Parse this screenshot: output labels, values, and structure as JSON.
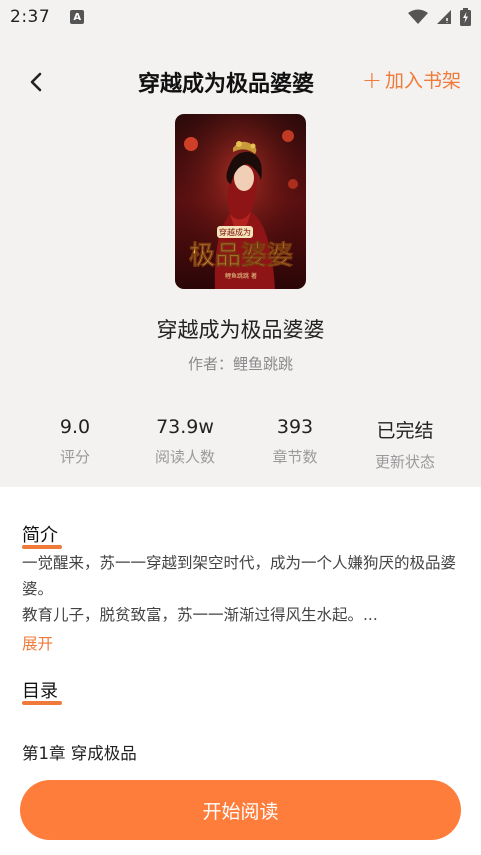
{
  "status_bar": {
    "time": "2:37",
    "notification_letter": "A"
  },
  "header": {
    "title": "穿越成为极品婆婆",
    "add_shelf": "加入书架"
  },
  "book": {
    "name": "穿越成为极品婆婆",
    "author_label": "作者：",
    "author": "鲤鱼跳跳",
    "cover_text_small": "穿越成为",
    "cover_text_big": "极品婆婆",
    "cover_author": "鲤鱼跳跳 著"
  },
  "stats": [
    {
      "value": "9.0",
      "label": "评分"
    },
    {
      "value": "73.9w",
      "label": "阅读人数"
    },
    {
      "value": "393",
      "label": "章节数"
    },
    {
      "value": "已完结",
      "label": "更新状态"
    }
  ],
  "intro": {
    "title": "简介",
    "line1": "一觉醒来，苏一一穿越到架空时代，成为一个人嫌狗厌的极品婆婆。",
    "line2": "教育儿子，脱贫致富，苏一一渐渐过得风生水起。...",
    "expand": "展开"
  },
  "toc": {
    "title": "目录",
    "first_chapter": "第1章  穿成极品"
  },
  "read_button": "开始阅读",
  "colors": {
    "accent": "#f07a3a",
    "button": "#ff7d3b",
    "background": "#f4f2f1"
  }
}
